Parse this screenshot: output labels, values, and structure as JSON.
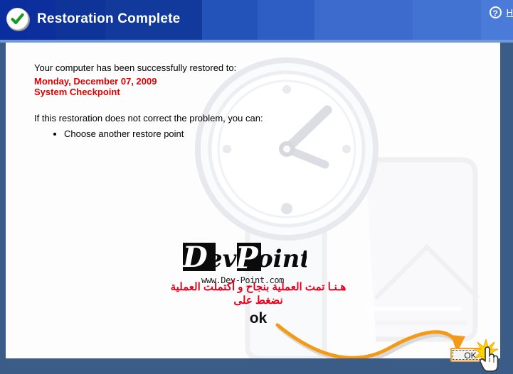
{
  "window": {
    "title": "Restoration Complete",
    "title_icon": "green-check-circle-icon",
    "frame_color": "#3a5c87",
    "header_color_left": "#0a2d9c",
    "header_color_right": "#4a7ad4"
  },
  "header": {
    "help_icon_glyph": "?",
    "help_icon_name": "question-mark-icon",
    "help_label": "H"
  },
  "body": {
    "intro_line": "Your computer has been successfully restored to:",
    "restore_date": "Monday, December 07, 2009",
    "restore_type": "System Checkpoint",
    "restore_text_color": "#e00000",
    "advice_line": "If this restoration does not correct the problem, you can:",
    "options": [
      "Choose another restore point"
    ]
  },
  "watermark": {
    "logo_text": "DevPoint",
    "logo_part_1": "D",
    "logo_part_2": "ev",
    "logo_part_3": "P",
    "logo_part_4": "oint",
    "url": "www.Dev-Point.com",
    "background_art": "wristwatch-clock-icon"
  },
  "annotation": {
    "line1": "هـنـا تمت العملية بنجاح و أكتملت العملية",
    "line2": "نضغط على",
    "line3": "ok",
    "text_color": "#e3001b",
    "arrow_color": "#f59a16",
    "arrow_name": "curved-pointer-arrow"
  },
  "footer": {
    "ok_button_label": "OK",
    "ok_button_border": "#f0a02a",
    "cursor": "hand-pointer-cursor",
    "click_effect": "click-burst-star"
  }
}
